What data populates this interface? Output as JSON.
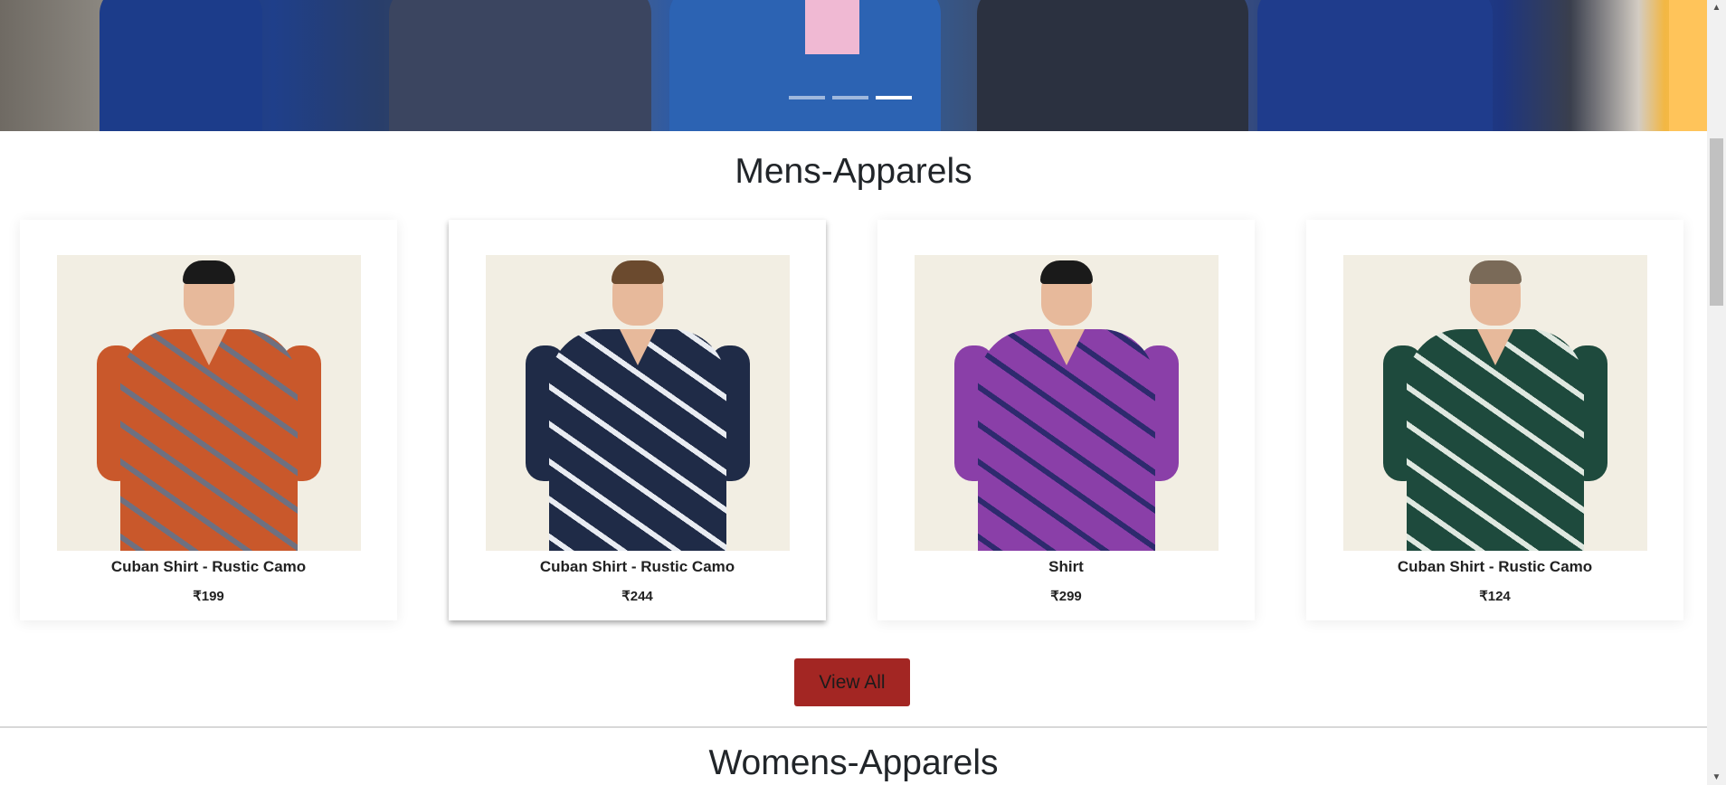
{
  "carousel": {
    "slide_count": 3,
    "active_index": 2
  },
  "mens_section": {
    "title": "Mens-Apparels",
    "products": [
      {
        "name": "Cuban Shirt - Rustic Camo",
        "price": "₹199",
        "shirt_color": "#c9582b",
        "shirt_accent": "#6e7080",
        "hair": "#1a1a1a"
      },
      {
        "name": "Cuban Shirt - Rustic Camo",
        "price": "₹244",
        "shirt_color": "#1f2b47",
        "shirt_accent": "#e9ecf2",
        "hair": "#6b4a2e"
      },
      {
        "name": "Shirt",
        "price": "₹299",
        "shirt_color": "#8a3fa8",
        "shirt_accent": "#2e2a6e",
        "hair": "#1a1a1a"
      },
      {
        "name": "Cuban Shirt - Rustic Camo",
        "price": "₹124",
        "shirt_color": "#1e4a3d",
        "shirt_accent": "#dfe8e0",
        "hair": "#7a6a58"
      }
    ],
    "view_all_label": "View All"
  },
  "womens_section": {
    "title": "Womens-Apparels"
  },
  "colors": {
    "button": "#a32623",
    "image_background": "#f2eee3"
  }
}
